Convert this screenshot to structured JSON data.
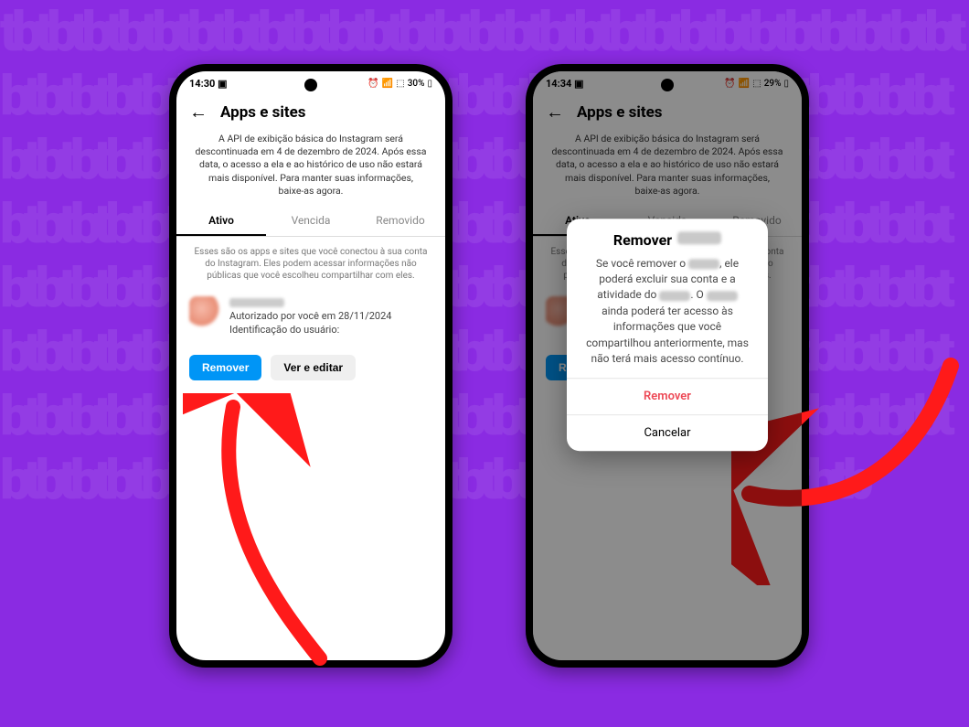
{
  "status_left": {
    "time": "14:30",
    "battery": "30%"
  },
  "status_right": {
    "time": "14:34",
    "battery": "29%"
  },
  "header": {
    "title": "Apps e sites"
  },
  "notice": "A API de exibição básica do Instagram será descontinuada em 4 de dezembro de 2024. Após essa data, o acesso a ela e ao histórico de uso não estará mais disponível. Para manter suas informações, baixe-as agora.",
  "tabs": {
    "active": "Ativo",
    "expired": "Vencida",
    "removed": "Removido"
  },
  "sub_text": "Esses são os apps e sites que você conectou à sua conta do Instagram. Eles podem acessar informações não públicas que você escolheu compartilhar com eles.",
  "app": {
    "auth_line": "Autorizado por você em 28/11/2024",
    "id_line": "Identificação do usuário:"
  },
  "buttons": {
    "remove": "Remover",
    "view_edit": "Ver e editar"
  },
  "dialog": {
    "title": "Remover",
    "body_1": "Se você remover o ",
    "body_2": ", ele poderá excluir sua conta e a atividade do ",
    "body_3": ". O ",
    "body_4": " ainda poderá ter acesso às informações que você compartilhou anteriormente, mas não terá mais acesso contínuo.",
    "action_remove": "Remover",
    "action_cancel": "Cancelar"
  }
}
